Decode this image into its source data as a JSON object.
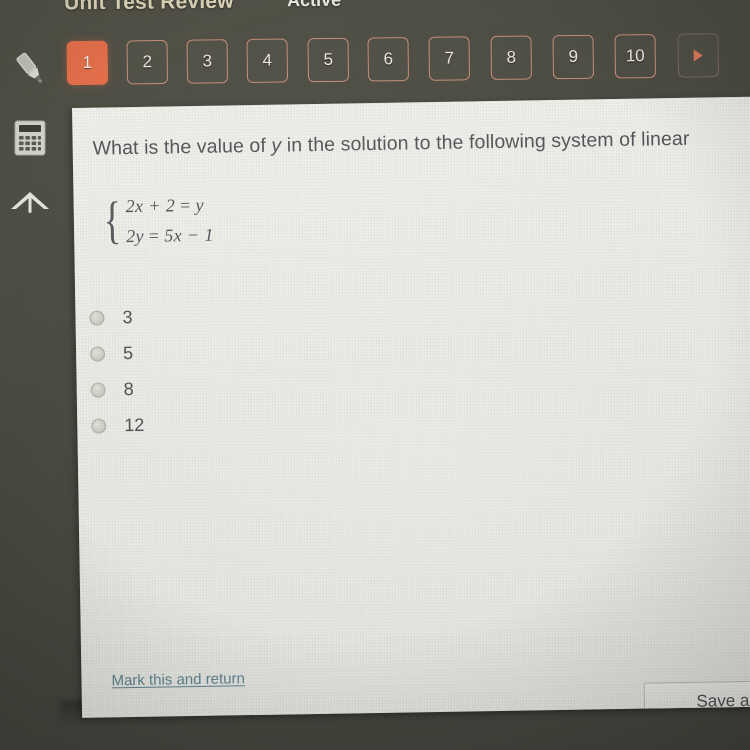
{
  "header": {
    "title": "Unit Test Review",
    "status": "Active"
  },
  "sidebar": {
    "items": [
      {
        "name": "highlighter-icon",
        "label": "Highlighter"
      },
      {
        "name": "calculator-icon",
        "label": "Calculator"
      },
      {
        "name": "scroll-up-icon",
        "label": "Scroll to top"
      }
    ]
  },
  "question_nav": {
    "tabs": [
      "1",
      "2",
      "3",
      "4",
      "5",
      "6",
      "7",
      "8",
      "9",
      "10"
    ],
    "selected": "1",
    "next_label": "▶"
  },
  "question": {
    "prompt_before": "What is the value of ",
    "prompt_italic": "y",
    "prompt_after": " in the solution to the following system of linear",
    "equations": [
      {
        "lhs": "2x + 2",
        "rel": "=",
        "rhs": "y"
      },
      {
        "lhs": "2y",
        "rel": "=",
        "rhs": "5x − 1"
      }
    ],
    "choices": [
      {
        "label": "3",
        "selected": false
      },
      {
        "label": "5",
        "selected": false
      },
      {
        "label": "8",
        "selected": false
      },
      {
        "label": "12",
        "selected": false
      }
    ]
  },
  "footer": {
    "mark_link": "Mark this and return",
    "save_button": "Save and Exit"
  },
  "colors": {
    "accent": "#e8714d",
    "tab_border": "#c98f78",
    "title": "#ded6b8",
    "background": "#4b4b43",
    "panel": "#eeeeea",
    "link": "#5f8793"
  }
}
